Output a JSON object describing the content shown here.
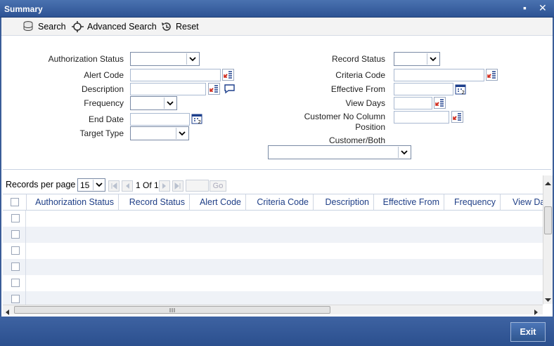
{
  "window": {
    "title": "Summary",
    "minimize": "▪",
    "close": "✕"
  },
  "toolbar": {
    "search": "Search",
    "advanced_search": "Advanced Search",
    "reset": "Reset"
  },
  "form": {
    "authorization_status": "Authorization Status",
    "alert_code": "Alert Code",
    "description": "Description",
    "frequency": "Frequency",
    "end_date": "End Date",
    "target_type": "Target Type",
    "record_status": "Record Status",
    "criteria_code": "Criteria Code",
    "effective_from": "Effective From",
    "view_days": "View Days",
    "customer_no_column_position": "Customer No Column Position",
    "customer_both": "Customer/Both"
  },
  "pager": {
    "records_per_page": "Records per page",
    "per_page_value": "15",
    "page_info": "1 Of 1",
    "go": "Go"
  },
  "grid": {
    "columns": [
      "Authorization Status",
      "Record Status",
      "Alert Code",
      "Criteria Code",
      "Description",
      "Effective From",
      "Frequency",
      "View Days"
    ]
  },
  "footer": {
    "exit": "Exit"
  }
}
